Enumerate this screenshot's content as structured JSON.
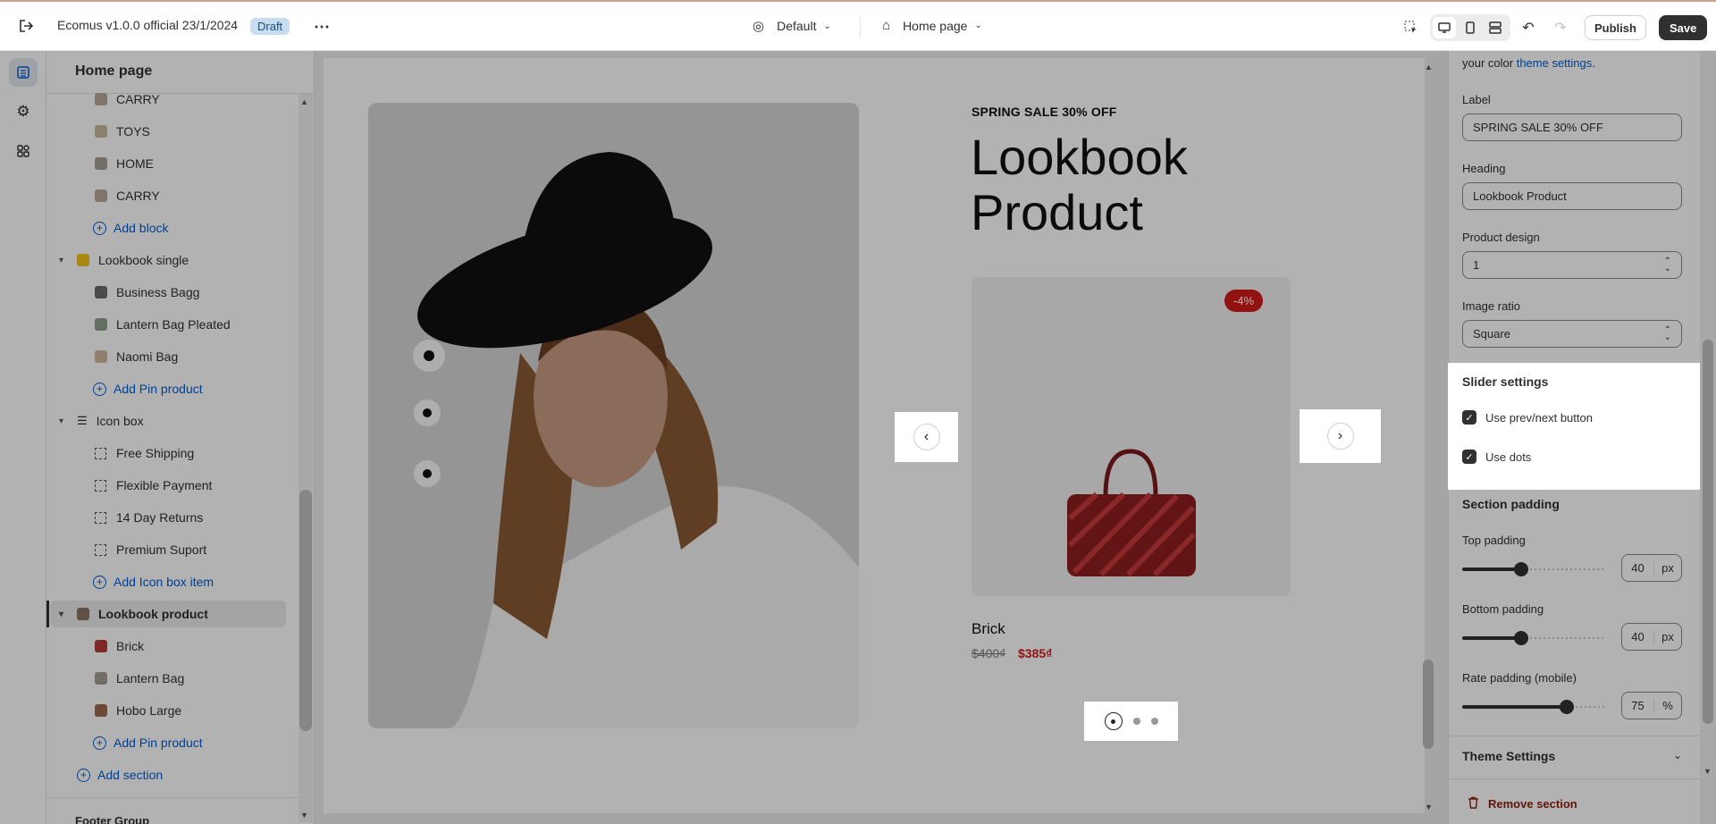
{
  "topbar": {
    "title": "Ecomus v1.0.0 official 23/1/2024",
    "badge": "Draft",
    "theme_select": "Default",
    "page_select": "Home page",
    "publish_label": "Publish",
    "save_label": "Save"
  },
  "sidebar": {
    "heading": "Home page",
    "items": [
      {
        "label": "CARRY"
      },
      {
        "label": "TOYS"
      },
      {
        "label": "HOME"
      },
      {
        "label": "CARRY"
      },
      {
        "label": "Add block"
      },
      {
        "label": "Lookbook single"
      },
      {
        "label": "Business Bagg"
      },
      {
        "label": "Lantern Bag Pleated"
      },
      {
        "label": "Naomi Bag"
      },
      {
        "label": "Add Pin product"
      },
      {
        "label": "Icon box"
      },
      {
        "label": "Free Shipping"
      },
      {
        "label": "Flexible Payment"
      },
      {
        "label": "14 Day Returns"
      },
      {
        "label": "Premium Suport"
      },
      {
        "label": "Add Icon box item"
      },
      {
        "label": "Lookbook product"
      },
      {
        "label": "Brick"
      },
      {
        "label": "Lantern Bag"
      },
      {
        "label": "Hobo Large"
      },
      {
        "label": "Add Pin product"
      },
      {
        "label": "Add section"
      },
      {
        "label": "Footer Group"
      }
    ]
  },
  "preview": {
    "subheading": "SPRING SALE 30% OFF",
    "heading_line1": "Lookbook",
    "heading_line2": "Product",
    "discount_badge": "-4%",
    "product_name": "Brick",
    "price_old": "$400₫",
    "price_new": "$385₫"
  },
  "settings": {
    "intro_text": "your color",
    "intro_link": "theme settings",
    "intro_period": ".",
    "label_title": "Label",
    "label_value": "SPRING SALE 30% OFF",
    "heading_title": "Heading",
    "heading_value": "Lookbook Product",
    "product_design_title": "Product design",
    "product_design_value": "1",
    "image_ratio_title": "Image ratio",
    "image_ratio_value": "Square",
    "slider_settings_title": "Slider settings",
    "use_prev_next": "Use prev/next button",
    "use_dots": "Use dots",
    "section_padding_title": "Section padding",
    "top_padding_title": "Top padding",
    "top_padding_value": "40",
    "top_padding_unit": "px",
    "bottom_padding_title": "Bottom padding",
    "bottom_padding_value": "40",
    "bottom_padding_unit": "px",
    "rate_padding_title": "Rate padding (mobile)",
    "rate_padding_value": "75",
    "rate_padding_unit": "%",
    "theme_settings_title": "Theme Settings",
    "remove_section": "Remove section"
  },
  "colors": {
    "accent_link": "#005bd3",
    "discount": "#d11a1a",
    "primary_button": "#303030"
  }
}
